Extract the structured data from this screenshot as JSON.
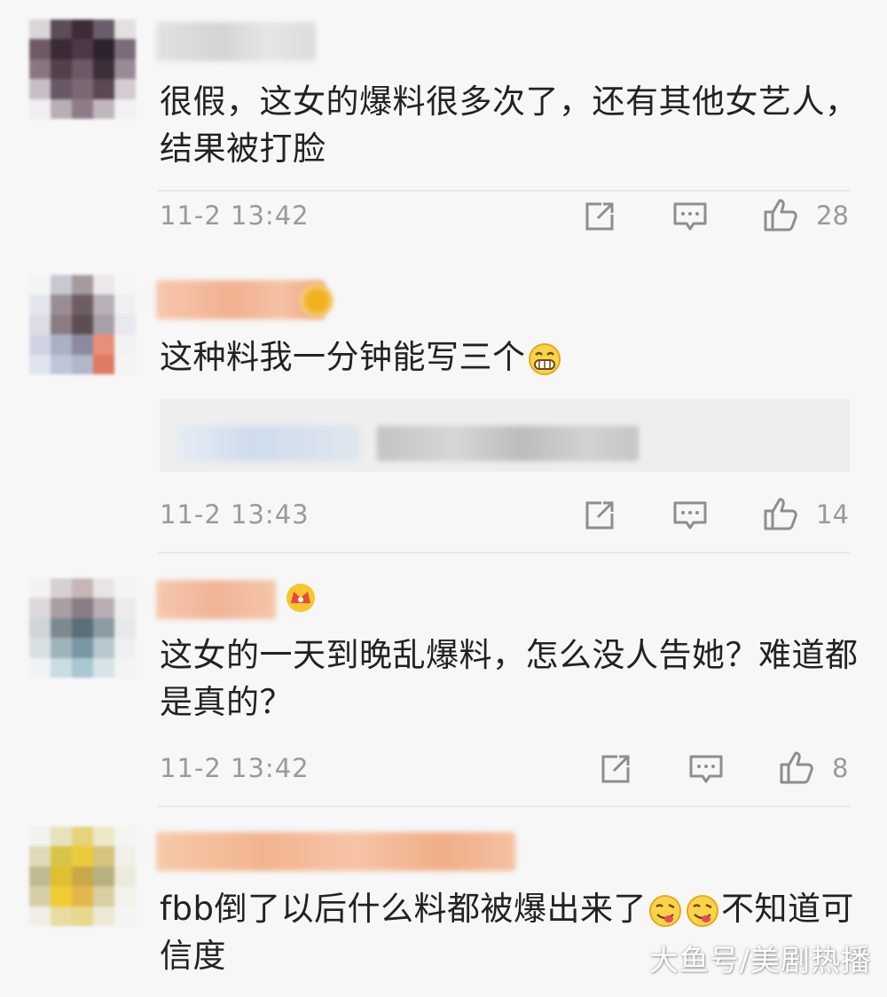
{
  "colors": {
    "background": "#f7f7f7",
    "text": "#222222",
    "meta": "#9a9a9a"
  },
  "comments": [
    {
      "text": "很假，这女的爆料很多次了，还有其他女艺人，结果被打脸",
      "time": "11-2 13:42",
      "likes": "28"
    },
    {
      "text": "这种料我一分钟能写三个",
      "emoji": "grin-emoji",
      "time": "11-2 13:43",
      "likes": "14"
    },
    {
      "text": "这女的一天到晚乱爆料，怎么没人告她？难道都是真的？",
      "time": "11-2 13:42",
      "likes": "8"
    },
    {
      "text_before": "fbb倒了以后什么料都被爆出来了",
      "text_after": "不知道可信度",
      "emoji": "yum-emoji"
    }
  ],
  "icons": {
    "forward": "share-icon",
    "comment": "comment-icon",
    "like": "thumbs-up-icon"
  },
  "watermark": "大鱼号/美剧热播"
}
